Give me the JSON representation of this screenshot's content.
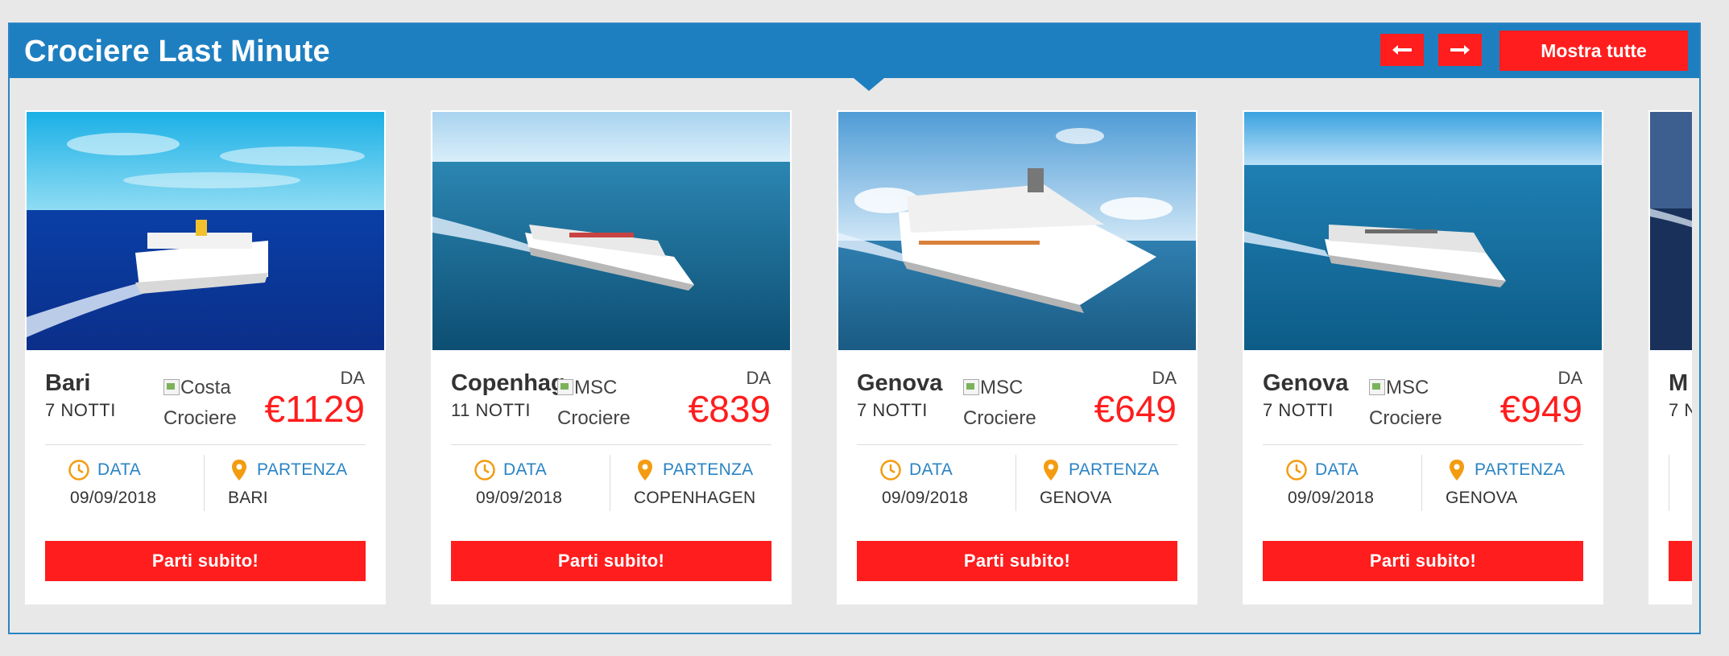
{
  "header": {
    "title": "Crociere Last Minute",
    "prev_icon": "arrow-left-icon",
    "next_icon": "arrow-right-icon",
    "show_all_label": "Mostra tutte"
  },
  "colors": {
    "header_blue": "#1e7fc0",
    "accent_red": "#ff1d1d",
    "label_blue": "#2a84c4",
    "icon_orange": "#f39c12"
  },
  "cards": [
    {
      "city": "Bari",
      "nights": "7 NOTTI",
      "logo_alt_1": "Costa",
      "logo_alt_2": "Crociere",
      "from_label": "DA",
      "price": "€1129",
      "date_label": "DATA",
      "date": "09/09/2018",
      "port_label": "PARTENZA",
      "port": "BARI",
      "cta": "Parti subito!"
    },
    {
      "city": "Copenhagen",
      "nights": "11 NOTTI",
      "logo_alt_1": "MSC",
      "logo_alt_2": "Crociere",
      "from_label": "DA",
      "price": "€839",
      "date_label": "DATA",
      "date": "09/09/2018",
      "port_label": "PARTENZA",
      "port": "COPENHAGEN",
      "cta": "Parti subito!"
    },
    {
      "city": "Genova",
      "nights": "7 NOTTI",
      "logo_alt_1": "MSC",
      "logo_alt_2": "Crociere",
      "from_label": "DA",
      "price": "€649",
      "date_label": "DATA",
      "date": "09/09/2018",
      "port_label": "PARTENZA",
      "port": "GENOVA",
      "cta": "Parti subito!"
    },
    {
      "city": "Genova",
      "nights": "7 NOTTI",
      "logo_alt_1": "MSC",
      "logo_alt_2": "Crociere",
      "from_label": "DA",
      "price": "€949",
      "date_label": "DATA",
      "date": "09/09/2018",
      "port_label": "PARTENZA",
      "port": "GENOVA",
      "cta": "Parti subito!"
    },
    {
      "city": "M",
      "nights": "7 N"
    }
  ]
}
